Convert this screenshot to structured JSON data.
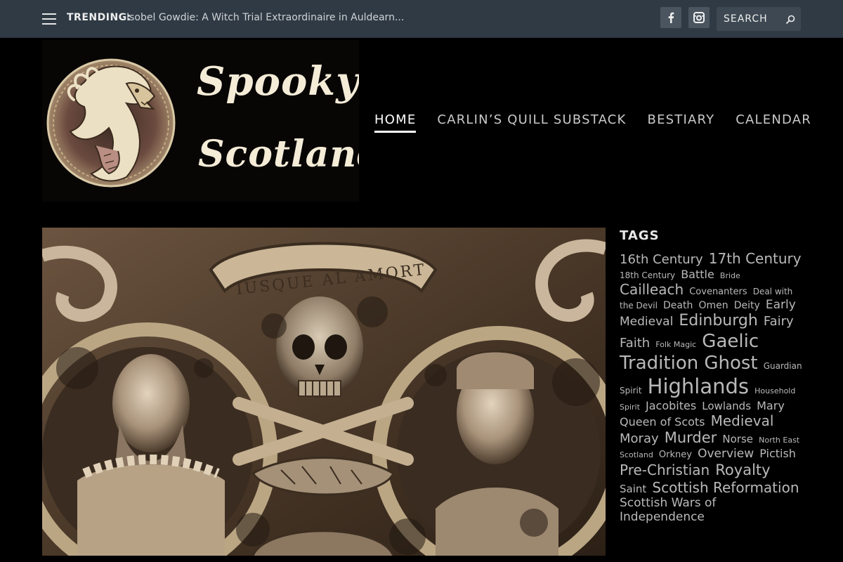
{
  "topbar": {
    "trending_label": "TRENDING:",
    "trending_text": "Isobel Gowdie: A Witch Trial Extraordinaire in Auldearn...",
    "search_placeholder": "SEARCH"
  },
  "logo": {
    "line1": "Spooky",
    "line2": "Scotland"
  },
  "nav": [
    {
      "label": "HOME",
      "active": true
    },
    {
      "label": "CARLIN’S QUILL SUBSTACK",
      "active": false
    },
    {
      "label": "BESTIARY",
      "active": false
    },
    {
      "label": "CALENDAR",
      "active": false
    }
  ],
  "feature": {
    "banner_text": "IUSQUE AL AMORT"
  },
  "tags": {
    "title": "TAGS",
    "items": [
      {
        "label": "16th Century",
        "size": 18
      },
      {
        "label": "17th Century",
        "size": 20
      },
      {
        "label": "18th Century",
        "size": 12
      },
      {
        "label": "Battle",
        "size": 16
      },
      {
        "label": "Bride",
        "size": 11
      },
      {
        "label": "Cailleach",
        "size": 20
      },
      {
        "label": "Covenanters",
        "size": 13
      },
      {
        "label": "Deal with the Devil",
        "size": 12
      },
      {
        "label": "Death",
        "size": 14
      },
      {
        "label": "Omen",
        "size": 14
      },
      {
        "label": "Deity",
        "size": 14
      },
      {
        "label": "Early Medieval",
        "size": 17
      },
      {
        "label": "Edinburgh",
        "size": 22
      },
      {
        "label": "Fairy Faith",
        "size": 18
      },
      {
        "label": "Folk Magic",
        "size": 11
      },
      {
        "label": "Gaelic Tradition",
        "size": 26
      },
      {
        "label": "Ghost",
        "size": 26
      },
      {
        "label": "Guardian Spirit",
        "size": 12
      },
      {
        "label": "Highlands",
        "size": 29
      },
      {
        "label": "Household Spirit",
        "size": 11
      },
      {
        "label": "Jacobites",
        "size": 16
      },
      {
        "label": "Lowlands",
        "size": 15
      },
      {
        "label": "Mary Queen of Scots",
        "size": 16
      },
      {
        "label": "Medieval",
        "size": 20
      },
      {
        "label": "Moray",
        "size": 18
      },
      {
        "label": "Murder",
        "size": 21
      },
      {
        "label": "Norse",
        "size": 15
      },
      {
        "label": "North East Scotland",
        "size": 11
      },
      {
        "label": "Orkney",
        "size": 13
      },
      {
        "label": "Overview",
        "size": 17
      },
      {
        "label": "Pictish",
        "size": 16
      },
      {
        "label": "Pre-Christian",
        "size": 20
      },
      {
        "label": "Royalty",
        "size": 21
      },
      {
        "label": "Saint",
        "size": 15
      },
      {
        "label": "Scottish Reformation",
        "size": 20
      },
      {
        "label": "Scottish Wars of Independence",
        "size": 17
      }
    ]
  },
  "colors": {
    "topbar": "#2f3a44",
    "background": "#000000",
    "tag": "#b9b9b9"
  }
}
